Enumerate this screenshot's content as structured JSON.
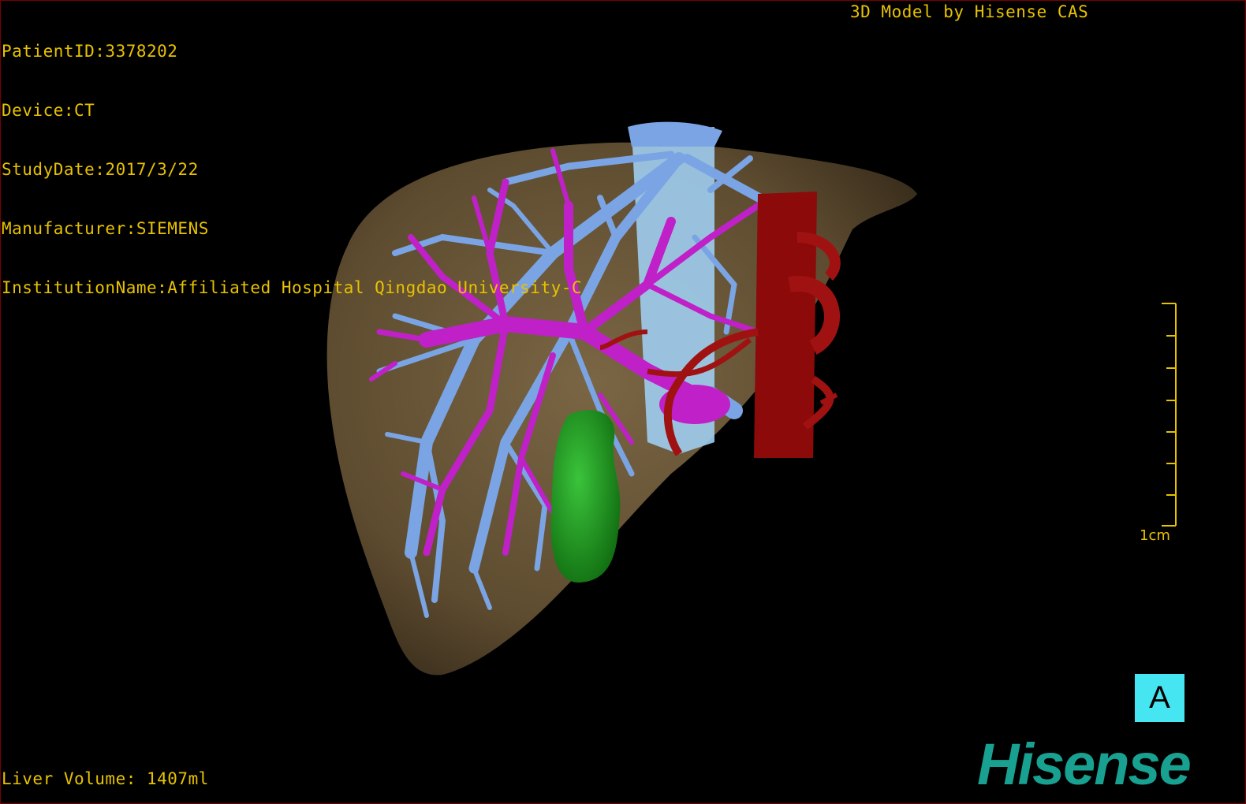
{
  "dicom_overlay": {
    "patient_id": "PatientID:3378202",
    "device": "Device:CT",
    "study_date": "StudyDate:2017/3/22",
    "manufacturer": "Manufacturer:SIEMENS",
    "institution": "InstitutionName:Affiliated Hospital Qingdao University-C"
  },
  "credit": "3D Model by Hisense CAS",
  "liver_volume": "Liver Volume: 1407ml",
  "scale_bar": {
    "label": "1cm"
  },
  "orientation_marker": "A",
  "brand_logo": "Hisense",
  "colors": {
    "liver": "#6e5a3a",
    "hepatic_vein": "#7aa4e4",
    "portal_vein": "#c020c8",
    "artery": "#8c0a0a",
    "gallbladder": "#1f9a1f",
    "overlay_text": "#e8c200",
    "orientation_marker_bg": "#45e6f2",
    "logo": "#18a191"
  },
  "model_structures": [
    "liver",
    "hepatic-veins",
    "portal-veins",
    "hepatic-artery-aorta",
    "gallbladder"
  ]
}
